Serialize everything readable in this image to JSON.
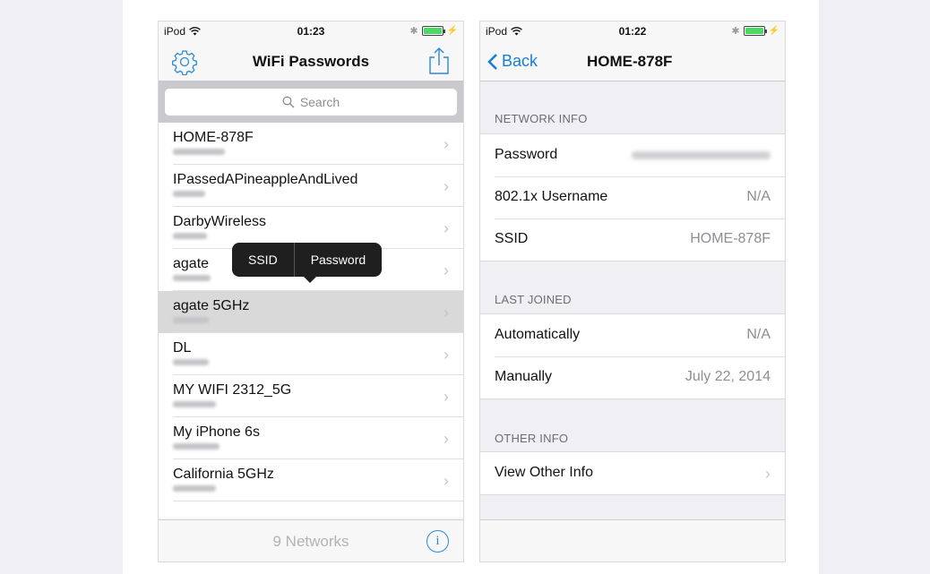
{
  "left_screen": {
    "status": {
      "carrier": "iPod",
      "time": "01:23"
    },
    "nav": {
      "title": "WiFi Passwords",
      "left_icon": "gear-icon",
      "right_icon": "share-icon"
    },
    "search": {
      "placeholder": "Search"
    },
    "networks": [
      {
        "ssid": "HOME-878F",
        "selected": false
      },
      {
        "ssid": "IPassedAPineappleAndLived",
        "selected": false
      },
      {
        "ssid": "DarbyWireless",
        "selected": false
      },
      {
        "ssid": "agate",
        "selected": false
      },
      {
        "ssid": "agate 5GHz",
        "selected": true
      },
      {
        "ssid": "DL",
        "selected": false
      },
      {
        "ssid": "MY WIFI 2312_5G",
        "selected": false
      },
      {
        "ssid": "My iPhone 6s",
        "selected": false
      },
      {
        "ssid": "California 5GHz",
        "selected": false
      }
    ],
    "popover": {
      "ssid_label": "SSID",
      "password_label": "Password"
    },
    "toolbar": {
      "count_text": "9 Networks",
      "info_icon": "info-icon"
    }
  },
  "right_screen": {
    "status": {
      "carrier": "iPod",
      "time": "01:22"
    },
    "nav": {
      "back_label": "Back",
      "title": "HOME-878F"
    },
    "sections": [
      {
        "header": "NETWORK INFO",
        "rows": [
          {
            "label": "Password",
            "value": "",
            "blurred": true
          },
          {
            "label": "802.1x Username",
            "value": "N/A"
          },
          {
            "label": "SSID",
            "value": "HOME-878F"
          }
        ]
      },
      {
        "header": "LAST JOINED",
        "rows": [
          {
            "label": "Automatically",
            "value": "N/A"
          },
          {
            "label": "Manually",
            "value": "July 22, 2014"
          }
        ]
      },
      {
        "header": "OTHER INFO",
        "rows": [
          {
            "label": "View Other Info",
            "value": "",
            "disclosure": true
          }
        ]
      }
    ]
  },
  "colors": {
    "accent": "#1a7ed4",
    "battery": "#4cd964",
    "popover": "#1f1f1f",
    "selected_row": "#d9d9d9",
    "grouped_bg": "#efeff4"
  }
}
